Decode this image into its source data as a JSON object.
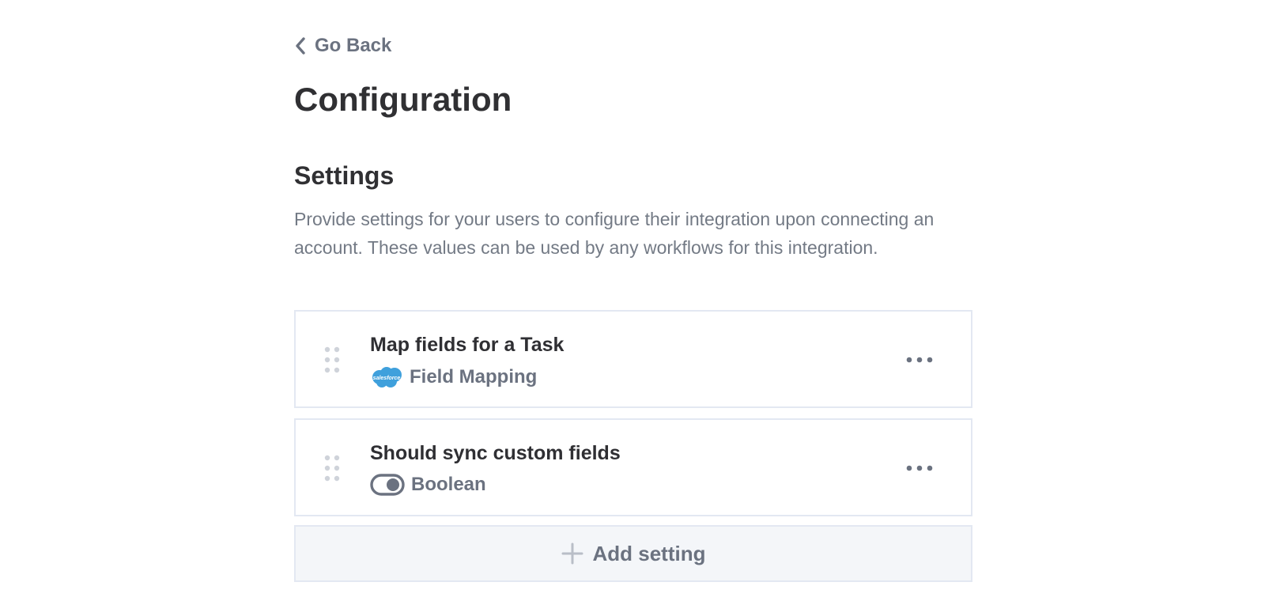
{
  "nav": {
    "back_label": "Go Back"
  },
  "page": {
    "title": "Configuration"
  },
  "settings": {
    "title": "Settings",
    "description": "Provide settings for your users to configure their integration upon connecting an account. These values can be used by any workflows for this integration.",
    "items": [
      {
        "title": "Map fields for a Task",
        "type_label": "Field Mapping",
        "icon": "salesforce-logo",
        "icon_text": "salesforce"
      },
      {
        "title": "Should sync custom fields",
        "type_label": "Boolean",
        "icon": "toggle-icon"
      }
    ],
    "add_label": "Add setting"
  },
  "colors": {
    "salesforce_blue": "#3fa0dc",
    "muted_text": "#737a85",
    "border": "#e3e8f2",
    "add_bg": "#f4f6f9"
  }
}
